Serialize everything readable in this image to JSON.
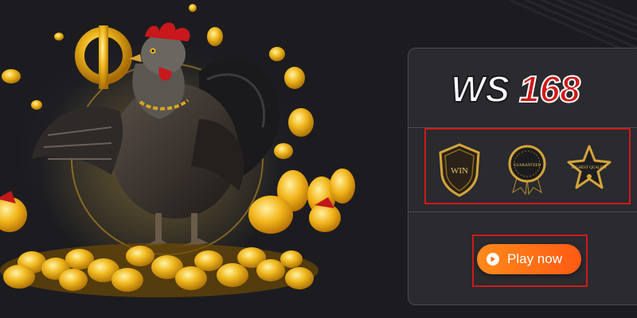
{
  "brand": {
    "logo_text": "WS168",
    "logo_colors": {
      "ws": "#ffffff",
      "num": "#d01a1a"
    }
  },
  "badges": [
    {
      "icon": "win-shield-icon",
      "text": "WIN"
    },
    {
      "icon": "guarantee-seal-icon",
      "text": "GUARANTEED"
    },
    {
      "icon": "highest-quality-star-icon",
      "text": "HIGHEST QUALITY"
    }
  ],
  "cta": {
    "label": "Play now",
    "icon": "play-circle-icon"
  },
  "colors": {
    "background": "#1c1c20",
    "panel": "#2a2a2f",
    "highlight_border": "#d01a1a",
    "button": "#ff6a14",
    "gold": "#f0b81e"
  }
}
